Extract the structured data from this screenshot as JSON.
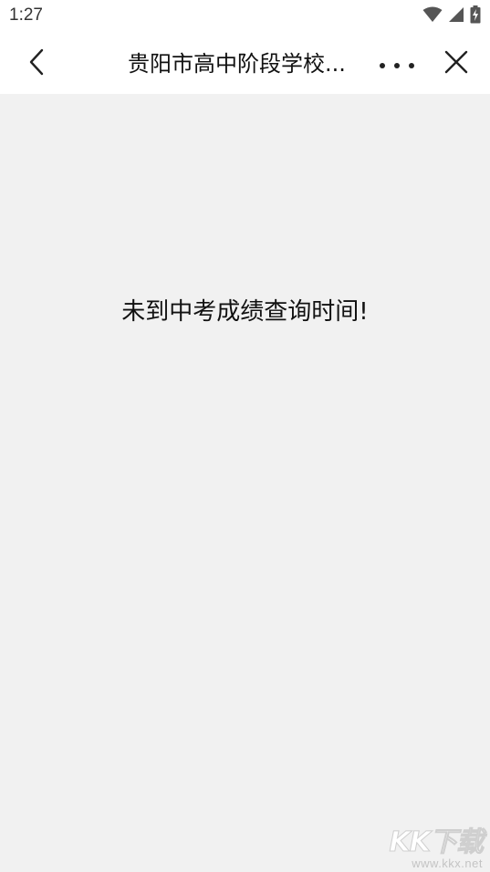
{
  "status_bar": {
    "time": "1:27",
    "icons": [
      "wifi-icon",
      "signal-icon",
      "battery-charging-icon"
    ]
  },
  "nav_bar": {
    "back_icon": "chevron-left-icon",
    "title": "贵阳市高中阶段学校...",
    "more_icon": "more-dots-icon",
    "close_icon": "close-icon"
  },
  "content": {
    "message": "未到中考成绩查询时间!"
  },
  "watermark": {
    "logo": "KK下载",
    "url": "www.kkx.net"
  },
  "colors": {
    "background": "#f1f1f1",
    "bar": "#ffffff",
    "text": "#111111"
  }
}
